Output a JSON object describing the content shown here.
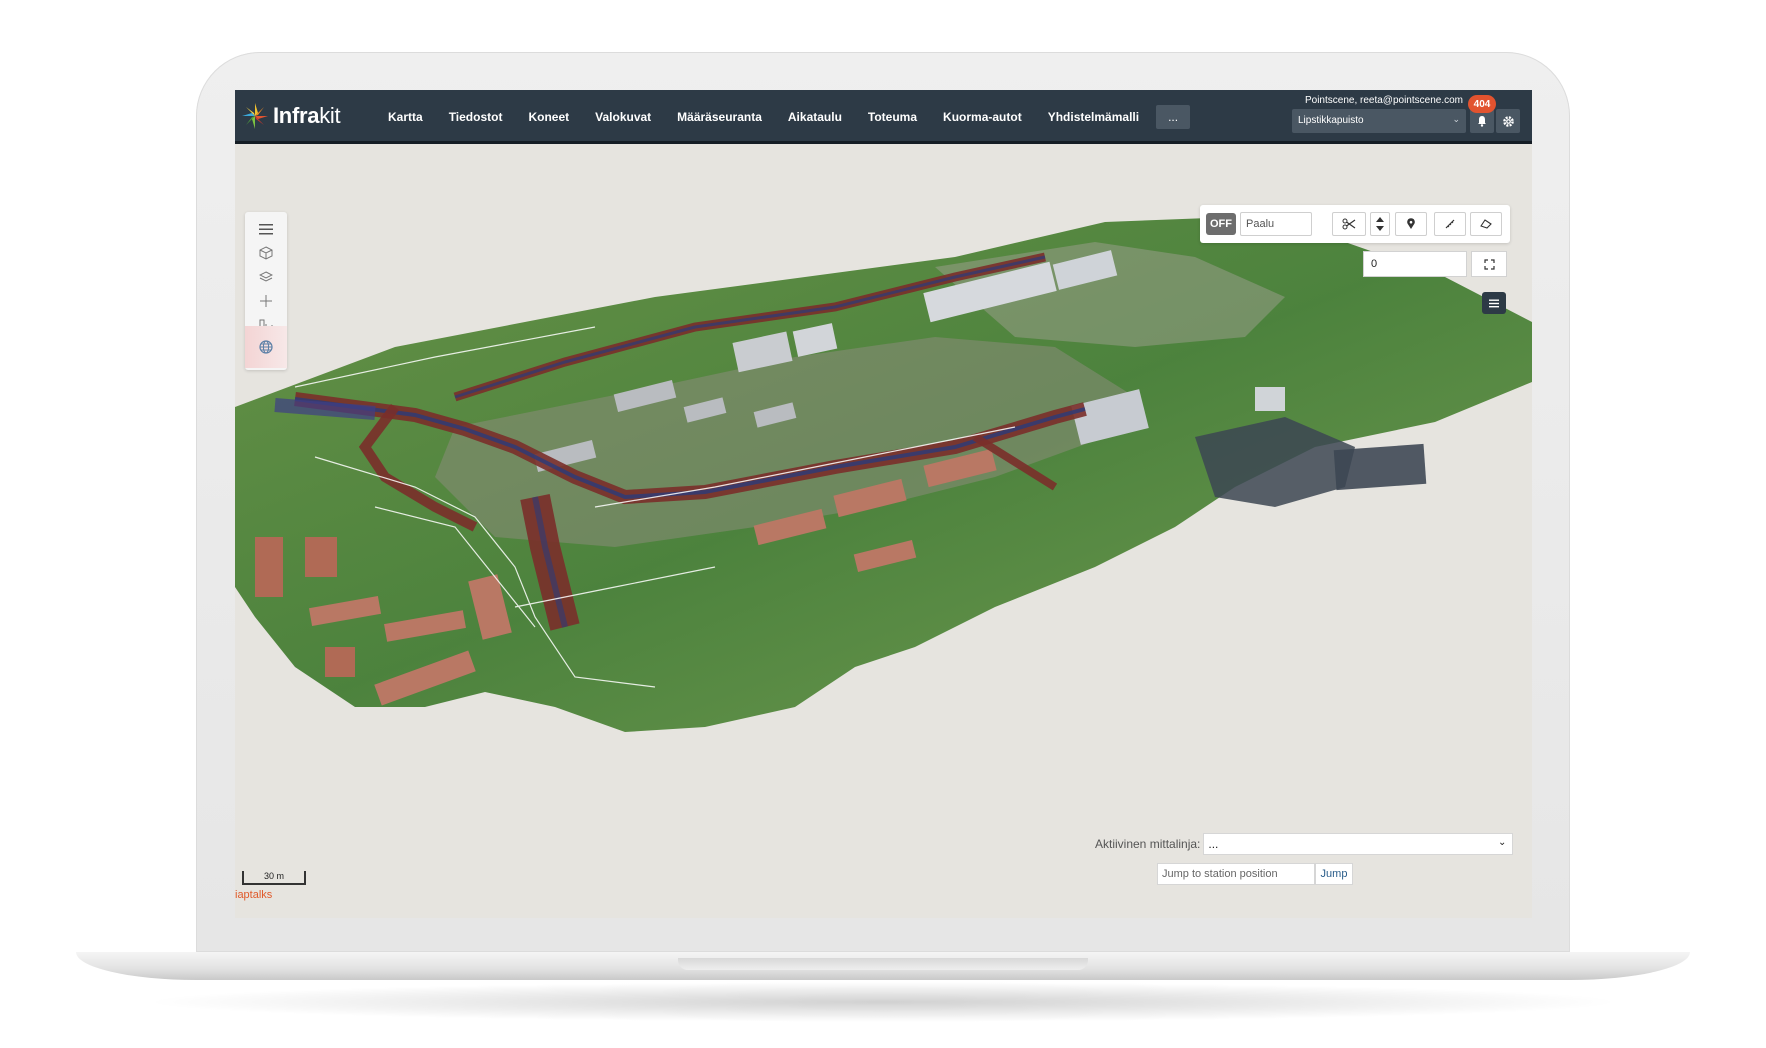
{
  "app": {
    "logo_text_bold": "Infra",
    "logo_text_light": "kit",
    "nav_items": [
      "Kartta",
      "Tiedostot",
      "Koneet",
      "Valokuvat",
      "Määräseuranta",
      "Aikataulu",
      "Toteuma",
      "Kuorma-autot",
      "Yhdistelmämalli"
    ],
    "nav_more": "...",
    "user": "Pointscene, reeta@pointscene.com",
    "project": "Lipstikkapuisto",
    "notifications_count": "404"
  },
  "toolbar": {
    "off_label": "OFF",
    "paalu_placeholder": "Paalu",
    "number_value": "0"
  },
  "bottom": {
    "mittalinja_label": "Aktiivinen mittalinja:",
    "mittalinja_value": "...",
    "jump_placeholder": "Jump to station position",
    "jump_button": "Jump",
    "scale_label": "30 m",
    "attribution": "iaptalks"
  },
  "colors": {
    "topbar": "#2d3a46",
    "accent": "#e2532f",
    "canvas": "#e6e4df"
  },
  "icons": [
    "menu-icon",
    "cube-icon",
    "layers-icon",
    "crosshair-icon",
    "chart-icon",
    "globe-icon",
    "scissors-icon",
    "arrow-up-icon",
    "arrow-down-icon",
    "pin-icon",
    "ruler-icon",
    "polygon-icon",
    "expand-icon",
    "list-icon",
    "bell-icon",
    "gear-icon",
    "chevron-down-icon"
  ]
}
